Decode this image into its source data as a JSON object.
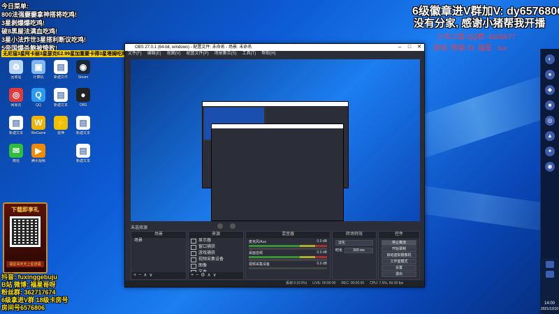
{
  "overlay_left": {
    "menu_title": "今日菜单:",
    "menu_items": [
      "800法强嫑嫑拿神搭将吃鸡!",
      "3星剥爆爆吃鸡!",
      "破8黑屋法满血吃鸡!",
      "3星小法炸世3星搭利断议吃鸡!",
      "5帝国爆杀鲍被惨败!",
      "无尼寇3星阿卡丽3星瑟克E2.99星加重要卡得3星塔姆吃鸡!"
    ],
    "bottom_lines": [
      "抖音: fuxinggebuju",
      "B站 微博: 福星哥呀",
      "粉丝群: 362717674",
      "6级拿进V群 18级卡房号",
      "房间号6576806"
    ]
  },
  "overlay_top_right": {
    "line1": "6级徽章进V群加V: dy6576806",
    "line2": "没有分家, 感谢小猪帮我开播",
    "line3": "少年三国 QQ群: 4606677",
    "line4": "游戏: 熊猫 ID: 福星 · txx"
  },
  "promo": {
    "title": "下载即享礼",
    "footer": "福星哥天天上星送福"
  },
  "desktop_icons": [
    {
      "label": "回收站",
      "color": "#b9d8f5",
      "glyph": "♻"
    },
    {
      "label": "计算机",
      "color": "#7fb6ef",
      "glyph": "▣"
    },
    {
      "label": "新建文件",
      "color": "#ffffff",
      "glyph": "▤"
    },
    {
      "label": "Steam",
      "color": "#1b2838",
      "glyph": "◉"
    },
    {
      "label": "网易云",
      "color": "#e23a3a",
      "glyph": "◎"
    },
    {
      "label": "QQ",
      "color": "#2a9bf0",
      "glyph": "Q"
    },
    {
      "label": "新建文本",
      "color": "#ffffff",
      "glyph": "▤"
    },
    {
      "label": "OBS",
      "color": "#222",
      "glyph": "●"
    },
    {
      "label": "新建文本",
      "color": "#ffffff",
      "glyph": "▤"
    },
    {
      "label": "WeGame",
      "color": "#f0b400",
      "glyph": "W"
    },
    {
      "label": "雷神",
      "color": "#f0c000",
      "glyph": "⚡"
    },
    {
      "label": "新建文本",
      "color": "#ffffff",
      "glyph": "▤"
    },
    {
      "label": "微信",
      "color": "#2fbd3c",
      "glyph": "✉"
    },
    {
      "label": "腾讯视频",
      "color": "#f08b00",
      "glyph": "▶"
    },
    {
      "label": "新建文本",
      "color": "#ffffff",
      "glyph": "▤"
    }
  ],
  "obs": {
    "title": "OBS 27.0.1 (64-bit, windows) - 配置文件: 未命名 - 场景: 未命名",
    "menu": [
      "文件(F)",
      "编辑(E)",
      "视图(V)",
      "配置文件(P)",
      "场景集合(S)",
      "工具(T)",
      "帮助(H)"
    ],
    "source_bar_label": "未选择源",
    "docks": {
      "scenes": {
        "title": "场景",
        "items": [
          "场景"
        ]
      },
      "sources": {
        "title": "来源",
        "items": [
          "显示器",
          "窗口捕获",
          "游戏捕获",
          "视频采集设备",
          "图像",
          "文本"
        ]
      },
      "mixer": {
        "title": "混音器",
        "channels": [
          {
            "name": "麦克风/Aux",
            "level": "0.0 dB"
          },
          {
            "name": "桌面音频",
            "level": "0.0 dB"
          },
          {
            "name": "视频采集设备",
            "level": "0.0 dB"
          }
        ]
      },
      "transitions": {
        "title": "转场特效",
        "type": "淡化",
        "duration_label": "时长",
        "duration": "300 ms"
      },
      "controls": {
        "title": "控件",
        "buttons": [
          "停止推流",
          "开始录制",
          "启动虚拟摄像机",
          "工作室模式",
          "设置",
          "退出"
        ]
      }
    },
    "status": {
      "drop": "丢帧 0 (0.0%)",
      "live": "LIVE: 00:00:00",
      "rec": "REC: 00:00:00",
      "cpu": "CPU: 7.5%, 60.00 fps"
    }
  },
  "tray": {
    "time": "14:00",
    "date": "2021/12/10"
  }
}
